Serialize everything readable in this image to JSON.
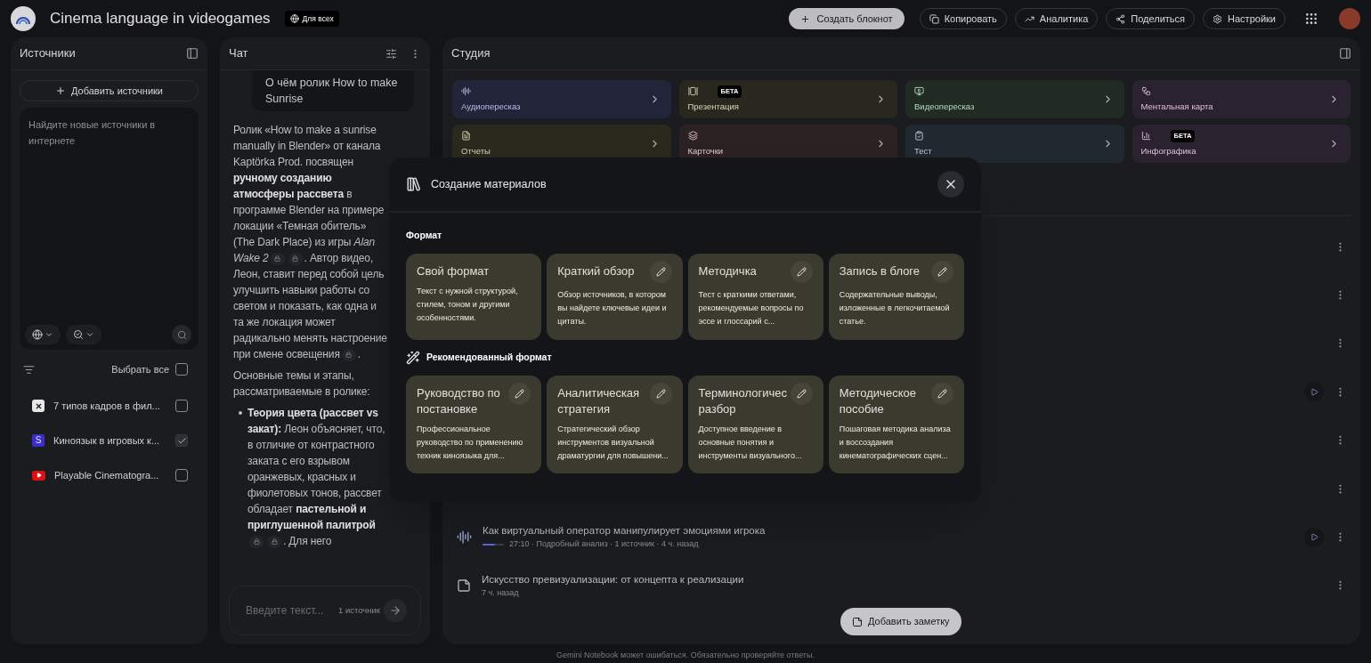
{
  "top_bar": {
    "title": "Cinema language in videogames",
    "visibility_badge": "Для всех",
    "create_button": "Создать блокнот",
    "actions": [
      {
        "kind": "copy",
        "label": "Копировать"
      },
      {
        "kind": "analytics",
        "label": "Аналитика"
      },
      {
        "kind": "share",
        "label": "Поделиться"
      },
      {
        "kind": "settings",
        "label": "Настройки"
      }
    ]
  },
  "sources": {
    "title": "Источники",
    "add_button": "Добавить источники",
    "search": {
      "placeholder": "Найдите новые источники в интернете"
    },
    "select_all": {
      "label": "Выбрать все",
      "checked": false
    },
    "items": [
      {
        "kind": "app",
        "title": "7 типов кадров в фил...",
        "checked": false
      },
      {
        "kind": "doc",
        "badge": "S",
        "title": "Киноязык в игровых к...",
        "checked": true
      },
      {
        "kind": "video",
        "title": "Playable Cinematogra...",
        "checked": false
      }
    ]
  },
  "chat": {
    "title": "Чат",
    "user_message": "О чём ролик How to make Sunrise",
    "answer": [
      {
        "kind": "paragraph",
        "parts": [
          {
            "kind": "text",
            "text": "Ролик «How to make a sunrise manually in Blender» от канала Kaptörka Prod. посвящен **ручному созданию атмосферы рассвета** в программе Blender на примере локации «Темная обитель» (The Dark Place) из игры *Alan Wake 2*"
          },
          {
            "kind": "citation"
          },
          {
            "kind": "citation"
          },
          {
            "kind": "text",
            "text": ". Автор видео, Леон, ставит перед собой цель улучшить навыки работы со светом и показать, как одна и та же локация может радикально менять настроение при смене освещения"
          },
          {
            "kind": "citation"
          },
          {
            "kind": "text",
            "text": "."
          }
        ]
      },
      {
        "kind": "paragraph",
        "parts": [
          {
            "kind": "text",
            "text": "Основные темы и этапы, рассматриваемые в ролике:"
          }
        ]
      },
      {
        "kind": "bullet",
        "parts": [
          {
            "kind": "text",
            "text": "**Теория цвета (рассвет vs закат):** Леон объясняет, что, в отличие от контрастного заката с его взрывом оранжевых, красных и фиолетовых тонов, рассвет обладает **пастельной и приглушенной палитрой**"
          },
          {
            "kind": "citation"
          },
          {
            "kind": "citation"
          },
          {
            "kind": "text",
            "text": ". Для него"
          }
        ]
      }
    ],
    "input": {
      "placeholder": "Введите текст...",
      "source_count": "1 источник"
    }
  },
  "studio": {
    "title": "Студия",
    "tiles": [
      {
        "kind": "audio",
        "label": "Аудиопересказ",
        "color": "#22243a"
      },
      {
        "kind": "slides",
        "label": "Презентация",
        "badge": "БЕТА",
        "color": "#28281f"
      },
      {
        "kind": "video",
        "label": "Видеопересказ",
        "color": "#212a23"
      },
      {
        "kind": "mindmap",
        "label": "Ментальная карта",
        "color": "#2a2230"
      },
      {
        "kind": "report",
        "label": "Отчеты",
        "color": "#29291e"
      },
      {
        "kind": "flashcards",
        "label": "Карточки",
        "color": "#2c2224"
      },
      {
        "kind": "quiz",
        "label": "Тест",
        "color": "#222830"
      },
      {
        "kind": "infographic",
        "label": "Инфографика",
        "badge": "БЕТА",
        "color": "#2b2230"
      }
    ],
    "notes": [
      {
        "kind": "covered",
        "playable": false
      },
      {
        "kind": "covered",
        "playable": false
      },
      {
        "kind": "covered",
        "playable": false
      },
      {
        "kind": "covered",
        "playable": true
      },
      {
        "kind": "covered",
        "playable": false
      },
      {
        "kind": "covered",
        "playable": false
      },
      {
        "kind": "audio",
        "title": "Как виртуальный оператор манипулирует эмоциями игрока",
        "meta": "27:10 · Подробный анализ · 1 источник · 4 ч. назад",
        "level": 0.6,
        "playable": true
      },
      {
        "kind": "note",
        "title": "Искусство превизуализации: от концепта к реализации",
        "meta": "7 ч. назад",
        "playable": false
      }
    ],
    "add_note_button": "Добавить заметку"
  },
  "dialog": {
    "title": "Создание материалов",
    "sections": [
      {
        "kind": "basic",
        "title": "Формат",
        "cards": [
          {
            "title": "Свой формат",
            "description": "Текст с нужной структурой, стилем, тоном и другими особенностями.",
            "editable": false
          },
          {
            "title": "Краткий обзор",
            "description": "Обзор источников, в котором вы найдете ключевые идеи и цитаты.",
            "editable": true
          },
          {
            "title": "Методичка",
            "description": "Тест с краткими ответами, рекомендуемые вопросы по эссе и глоссарий с...",
            "editable": true
          },
          {
            "title": "Запись в блоге",
            "description": "Содержательные выводы, изложенные в легкочитаемой статье.",
            "editable": true
          }
        ]
      },
      {
        "kind": "recommended",
        "title": "Рекомендованный формат",
        "cards": [
          {
            "title": "Руководство по постановке",
            "description": "Профессиональное руководство по применению техник киноязыка для...",
            "editable": true
          },
          {
            "title": "Аналитическая стратегия",
            "description": "Стратегический обзор инструментов визуальной драматургии для повышени...",
            "editable": true
          },
          {
            "title": "Терминологичес разбор",
            "description": "Доступное введение в основные понятия и инструменты визуального...",
            "editable": true
          },
          {
            "title": "Методическое пособие",
            "description": "Пошаговая методика анализа и воссоздания кинематографических сцен...",
            "editable": true
          }
        ]
      }
    ]
  },
  "footer": "Gemini Notebook может ошибаться. Обязательно проверяйте ответы."
}
